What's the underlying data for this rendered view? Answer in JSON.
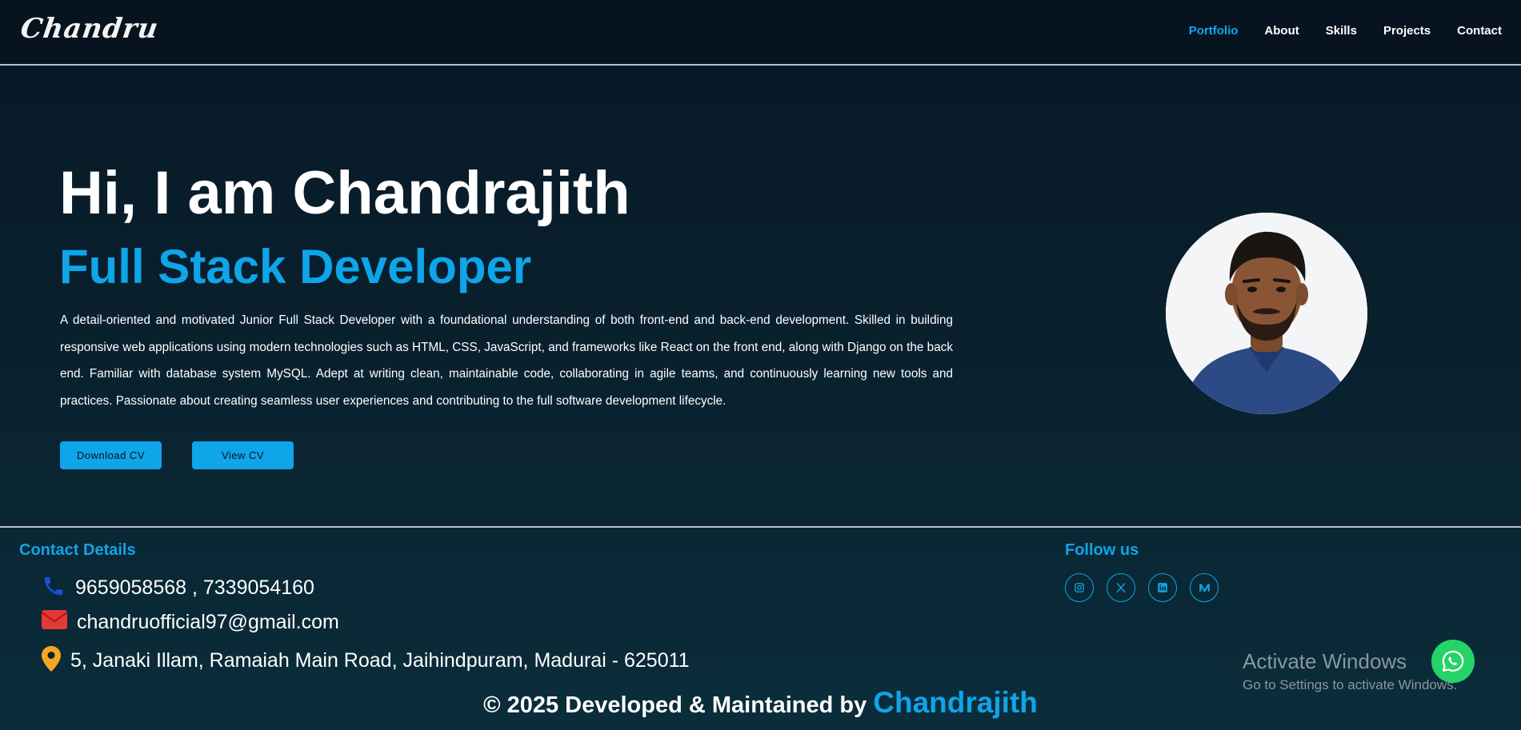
{
  "nav": {
    "logo": "Chandru",
    "links": [
      "Portfolio",
      "About",
      "Skills",
      "Projects",
      "Contact"
    ]
  },
  "hero": {
    "title": "Hi, I am Chandrajith",
    "subtitle": "Full Stack Developer",
    "description": "A detail-oriented and motivated Junior Full Stack Developer with a foundational understanding of both front-end and back-end development. Skilled in building responsive web applications using modern technologies such as HTML, CSS, JavaScript, and frameworks like React on the front end, along with Django on the back end. Familiar with database system MySQL. Adept at writing clean, maintainable code, collaborating in agile teams, and continuously learning new tools and practices. Passionate about creating seamless user experiences and contributing to the full software development lifecycle.",
    "download_cv": "Download CV",
    "view_cv": "View CV"
  },
  "contact": {
    "heading": "Contact Details",
    "phone": "9659058568 , 7339054160",
    "email": "chandruofficial97@gmail.com",
    "address": "5, Janaki Illam, Ramaiah Main Road, Jaihindpuram, Madurai - 625011"
  },
  "follow": {
    "heading": "Follow us",
    "icons": [
      "instagram-icon",
      "x-twitter-icon",
      "linkedin-icon",
      "medium-icon"
    ]
  },
  "footer": {
    "copyright_prefix": "© 2025 Developed & Maintained by",
    "copyright_name": "Chandrajith"
  },
  "os_overlay": {
    "line1": "Activate Windows",
    "line2": "Go to Settings to activate Windows."
  },
  "colors": {
    "accent": "#0ea5e9",
    "background": "#081827",
    "whatsapp": "#25d366"
  }
}
